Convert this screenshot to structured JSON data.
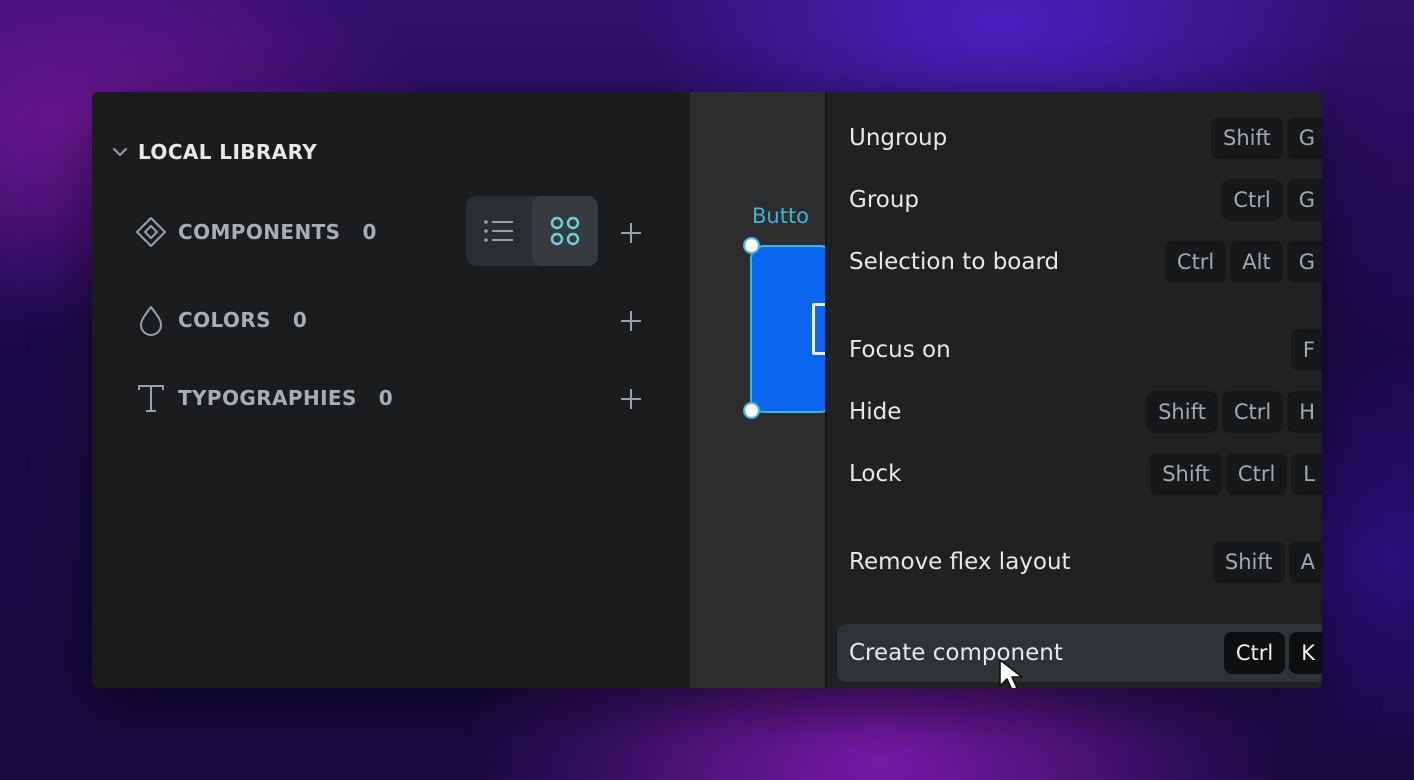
{
  "sidebar": {
    "section_title": "LOCAL LIBRARY",
    "rows": [
      {
        "label": "COMPONENTS",
        "count": "0",
        "icon": "component-icon"
      },
      {
        "label": "COLORS",
        "count": "0",
        "icon": "drop-icon"
      },
      {
        "label": "TYPOGRAPHIES",
        "count": "0",
        "icon": "text-icon"
      }
    ],
    "view_toggle": {
      "options": [
        "list-view-icon",
        "grid-view-icon"
      ],
      "active": "grid-view-icon"
    }
  },
  "canvas": {
    "element_label": "Butto",
    "selection_color": "#3fb8d9",
    "element_fill": "#0a66ee"
  },
  "context_menu": {
    "items": [
      {
        "text": "Ungroup",
        "keys": [
          "Shift",
          "G"
        ]
      },
      {
        "text": "Group",
        "keys": [
          "Ctrl",
          "G"
        ]
      },
      {
        "text": "Selection to board",
        "keys": [
          "Ctrl",
          "Alt",
          "G"
        ]
      },
      {
        "text": "Focus on",
        "keys": [
          "F"
        ]
      },
      {
        "text": "Hide",
        "keys": [
          "Shift",
          "Ctrl",
          "H"
        ]
      },
      {
        "text": "Lock",
        "keys": [
          "Shift",
          "Ctrl",
          "L"
        ]
      },
      {
        "text": "Remove flex layout",
        "keys": [
          "Shift",
          "A"
        ]
      },
      {
        "text": "Create component",
        "keys": [
          "Ctrl",
          "K"
        ],
        "highlighted": true
      }
    ]
  }
}
